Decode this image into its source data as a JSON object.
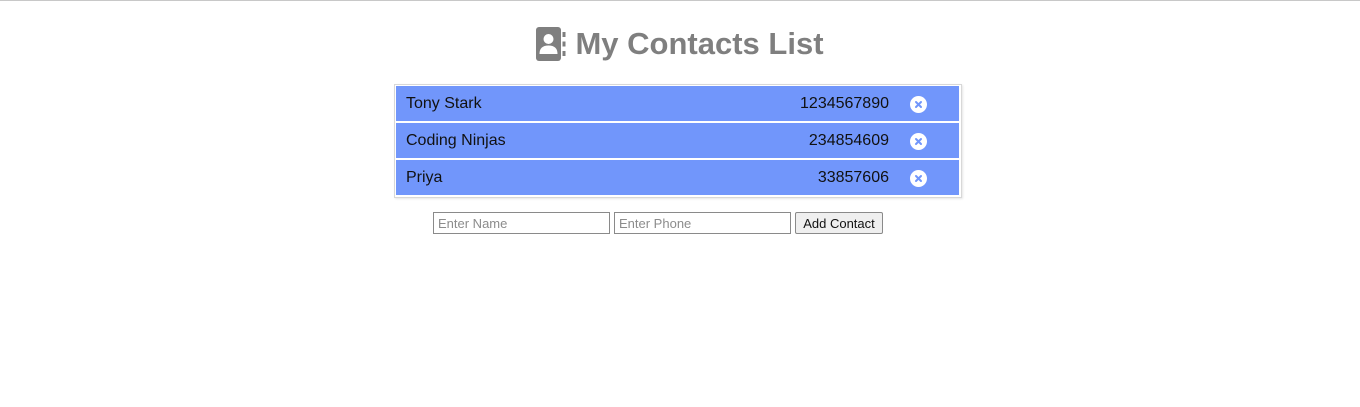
{
  "header": {
    "icon": "address-book-icon",
    "title": "My Contacts List",
    "title_color": "#7f7f7f"
  },
  "contacts": [
    {
      "name": "Tony Stark",
      "phone": "1234567890"
    },
    {
      "name": "Coding Ninjas",
      "phone": "234854609"
    },
    {
      "name": "Priya",
      "phone": "33857606"
    }
  ],
  "row_color": "#7196fb",
  "delete_icon": "circle-x-icon",
  "form": {
    "name_placeholder": "Enter Name",
    "phone_placeholder": "Enter Phone",
    "add_label": "Add Contact"
  }
}
